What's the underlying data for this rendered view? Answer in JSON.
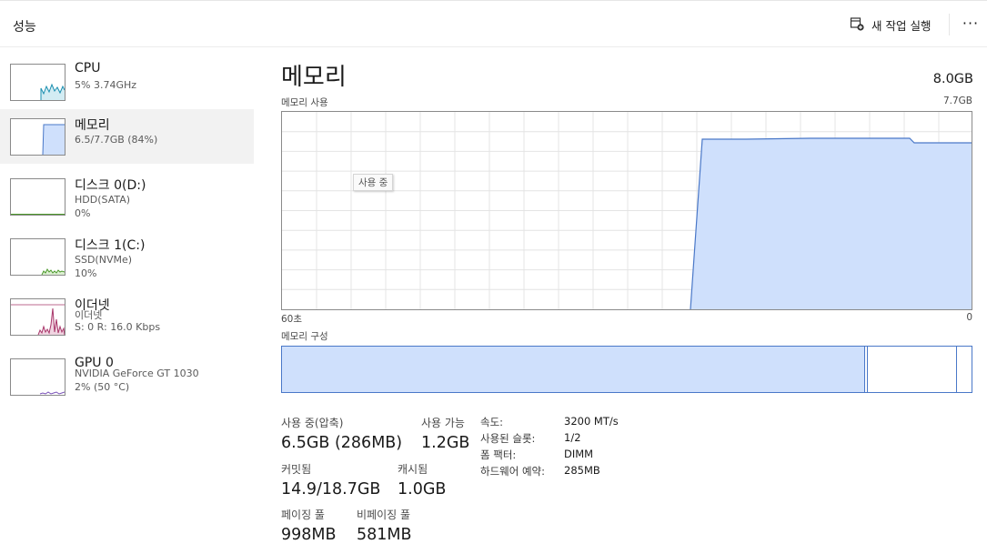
{
  "header": {
    "title": "성능",
    "run_task_label": "새 작업 실행",
    "more_label": "···"
  },
  "sidebar": {
    "items": [
      {
        "name": "CPU",
        "line1": "5% 3.74GHz",
        "line2": ""
      },
      {
        "name": "메모리",
        "line1": "6.5/7.7GB (84%)",
        "line2": ""
      },
      {
        "name": "디스크 0(D:)",
        "line1": "HDD(SATA)",
        "line2": "0%"
      },
      {
        "name": "디스크 1(C:)",
        "line1": "SSD(NVMe)",
        "line2": "10%"
      },
      {
        "name": "이더넷",
        "line1": "이더넷",
        "line2": "S: 0 R: 16.0 Kbps"
      },
      {
        "name": "GPU 0",
        "line1": "NVIDIA GeForce GT 1030",
        "line2": "2% (50 °C)"
      }
    ]
  },
  "main": {
    "title": "메모리",
    "total": "8.0GB",
    "usage_label": "메모리 사용",
    "usage_max": "7.7GB",
    "axis_left": "60초",
    "axis_right": "0",
    "tooltip": "사용 중",
    "composition_label": "메모리 구성",
    "stats": {
      "in_use_label": "사용 중(압축)",
      "in_use_value": "6.5GB (286MB)",
      "available_label": "사용 가능",
      "available_value": "1.2GB",
      "committed_label": "커밋됨",
      "committed_value": "14.9/18.7GB",
      "cached_label": "캐시됨",
      "cached_value": "1.0GB",
      "paged_label": "페이징 풀",
      "paged_value": "998MB",
      "nonpaged_label": "비페이징 풀",
      "nonpaged_value": "581MB"
    },
    "details": [
      {
        "label": "속도:",
        "value": "3200 MT/s"
      },
      {
        "label": "사용된 슬롯:",
        "value": "1/2"
      },
      {
        "label": "폼 팩터:",
        "value": "DIMM"
      },
      {
        "label": "하드웨어 예약:",
        "value": "285MB"
      }
    ]
  },
  "colors": {
    "memory_fill": "#cfe0fc",
    "memory_line": "#4a78c8",
    "cpu_line": "#1b8fb0",
    "disk_line": "#4d9a2c",
    "ethernet_line": "#a8366a",
    "gpu_line": "#7a52b8"
  },
  "icons": {
    "run_task": "new-task-icon",
    "more": "more-options-icon"
  }
}
